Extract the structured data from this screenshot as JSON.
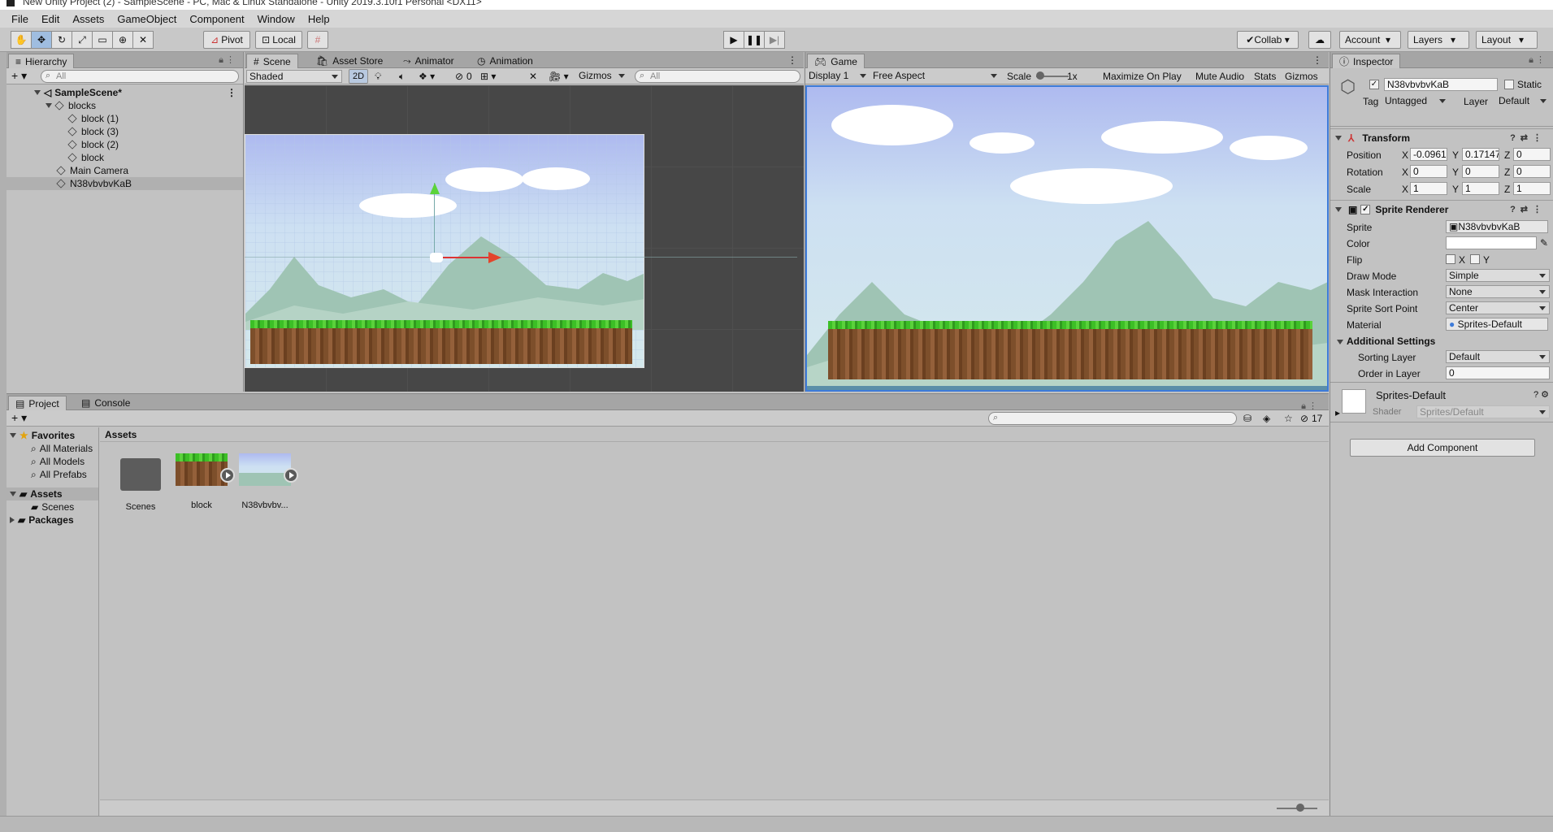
{
  "window": {
    "title": "New Unity Project (2) - SampleScene - PC, Mac & Linux Standalone - Unity 2019.3.10f1 Personal <DX11>"
  },
  "menu": [
    "File",
    "Edit",
    "Assets",
    "GameObject",
    "Component",
    "Window",
    "Help"
  ],
  "toolbar": {
    "pivot": "Pivot",
    "local": "Local",
    "collab": "Collab",
    "account": "Account",
    "layers": "Layers",
    "layout": "Layout"
  },
  "hierarchy": {
    "tab": "Hierarchy",
    "search_placeholder": "All",
    "scene": "SampleScene*",
    "items": [
      "blocks",
      "block (1)",
      "block (3)",
      "block (2)",
      "block",
      "Main Camera",
      "N38vbvbvKaB"
    ]
  },
  "scene_view": {
    "tabs": [
      "Scene",
      "Asset Store",
      "Animator",
      "Animation"
    ],
    "shading": "Shaded",
    "mode_2d": "2D",
    "hidden_count": "0",
    "gizmos": "Gizmos",
    "search_placeholder": "All"
  },
  "game_view": {
    "tab": "Game",
    "display": "Display 1",
    "aspect": "Free Aspect",
    "scale_label": "Scale",
    "scale_value": "1x",
    "maximize": "Maximize On Play",
    "mute": "Mute Audio",
    "stats": "Stats",
    "gizmos": "Gizmos"
  },
  "inspector": {
    "tab": "Inspector",
    "object_name": "N38vbvbvKaB",
    "static_label": "Static",
    "tag_label": "Tag",
    "tag_value": "Untagged",
    "layer_label": "Layer",
    "layer_value": "Default",
    "transform": {
      "title": "Transform",
      "position_label": "Position",
      "position": [
        "-0.0961",
        "0.17147",
        "0"
      ],
      "rotation_label": "Rotation",
      "rotation": [
        "0",
        "0",
        "0"
      ],
      "scale_label": "Scale",
      "scale": [
        "1",
        "1",
        "1"
      ]
    },
    "sprite_renderer": {
      "title": "Sprite Renderer",
      "sprite_label": "Sprite",
      "sprite": "N38vbvbvKaB",
      "color_label": "Color",
      "flip_label": "Flip",
      "flip_x": "X",
      "flip_y": "Y",
      "draw_mode_label": "Draw Mode",
      "draw_mode": "Simple",
      "mask_label": "Mask Interaction",
      "mask": "None",
      "sort_point_label": "Sprite Sort Point",
      "sort_point": "Center",
      "material_label": "Material",
      "material": "Sprites-Default",
      "additional": "Additional Settings",
      "sorting_layer_label": "Sorting Layer",
      "sorting_layer": "Default",
      "order_label": "Order in Layer",
      "order": "0"
    },
    "material_section": {
      "name": "Sprites-Default",
      "shader_label": "Shader",
      "shader": "Sprites/Default"
    },
    "add_component": "Add Component"
  },
  "project": {
    "tabs": [
      "Project",
      "Console"
    ],
    "hidden_count": "17",
    "favorites": "Favorites",
    "favorite_items": [
      "All Materials",
      "All Models",
      "All Prefabs"
    ],
    "assets_root": "Assets",
    "scenes_folder": "Scenes",
    "packages": "Packages",
    "breadcrumb": "Assets",
    "assets": [
      "Scenes",
      "block",
      "N38vbvbv..."
    ]
  },
  "colors": {
    "accent": "#3d7bd9",
    "tree_selection": "#b0b0b0"
  }
}
